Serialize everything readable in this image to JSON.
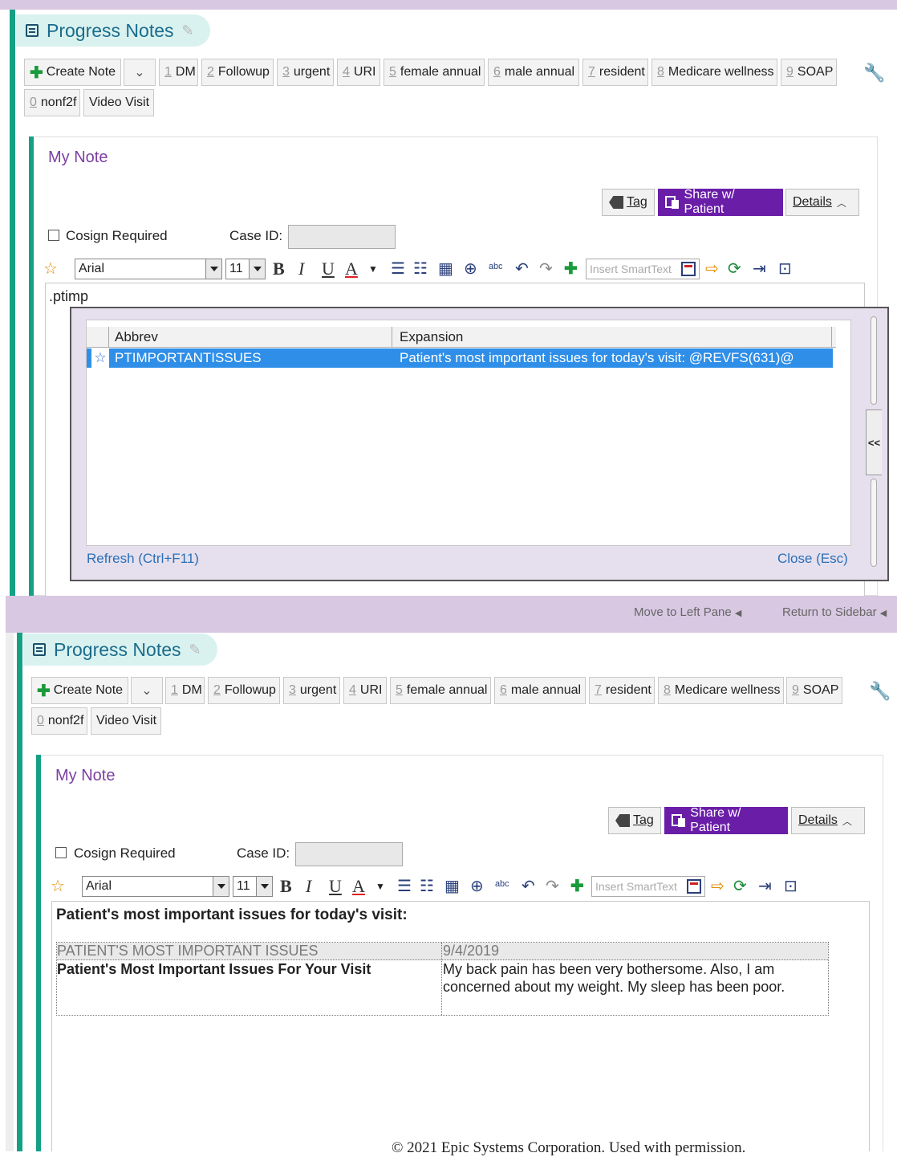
{
  "panel1": {
    "header": {
      "title": "Progress Notes"
    },
    "toolbar": {
      "create_note": "Create Note",
      "quick_buttons": [
        {
          "num": "1",
          "label": "DM"
        },
        {
          "num": "2",
          "label": "Followup"
        },
        {
          "num": "3",
          "label": "urgent"
        },
        {
          "num": "4",
          "label": "URI"
        },
        {
          "num": "5",
          "label": "female annual"
        },
        {
          "num": "6",
          "label": "male annual"
        },
        {
          "num": "7",
          "label": "resident"
        },
        {
          "num": "8",
          "label": "Medicare wellness"
        },
        {
          "num": "9",
          "label": "SOAP"
        },
        {
          "num": "0",
          "label": "nonf2f"
        },
        {
          "num": "",
          "label": "Video Visit"
        }
      ]
    },
    "note": {
      "title": "My Note",
      "tag_label": "Tag",
      "share_label": "Share w/ Patient",
      "details_label": "Details",
      "cosign_label": "Cosign Required",
      "caseid_label": "Case ID:",
      "font": "Arial",
      "font_size": "11",
      "smarttext_placeholder": "Insert SmartText",
      "editor_text": ".ptimp"
    },
    "popup": {
      "col_abbrev": "Abbrev",
      "col_expansion": "Expansion",
      "row_abbrev": "PTIMPORTANTISSUES",
      "row_expansion": "Patient's most important issues for today's visit:  @REVFS(631)@",
      "collapse": "<<",
      "refresh": "Refresh (Ctrl+F11)",
      "close": "Close (Esc)"
    }
  },
  "band": {
    "move_left": "Move to Left Pane",
    "return_sidebar": "Return to Sidebar"
  },
  "panel2": {
    "editor_heading": "Patient's most important issues for today's visit:",
    "table": {
      "header_left": "PATIENT'S MOST IMPORTANT ISSUES",
      "header_right": "9/4/2019",
      "row_label": "Patient's Most Important Issues For Your Visit",
      "row_text_line1": "My back pain has been very bothersome.  Also, I am",
      "row_text_line2": "concerned about my weight.  My sleep has been poor."
    }
  },
  "copyright": "© 2021 Epic Systems Corporation. Used with permission.",
  "colors": {
    "accent_green": "#14a083",
    "share_purple": "#6a1ea8",
    "selection_blue": "#2f8fe8",
    "band_purple": "#d8c8e2"
  }
}
